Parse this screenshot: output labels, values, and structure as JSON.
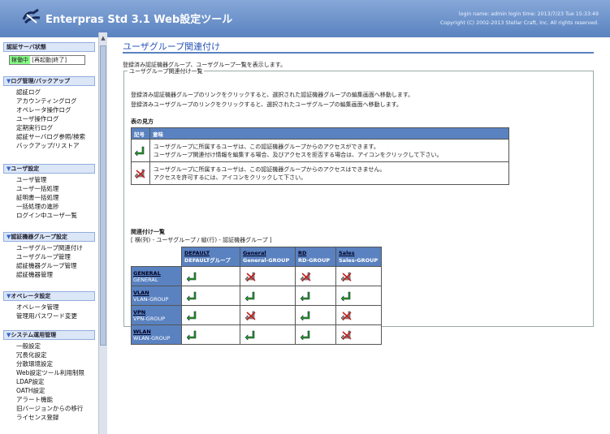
{
  "header": {
    "title": "Enterpras Std 3.1 Web設定ツール",
    "login_line": "login name: admin login time: 2013/7/23 Tue 15:33:49",
    "copyright_line": "Copyright (C) 2002-2013 Stellar Craft, Inc. All rights reserved."
  },
  "sidebar": {
    "server_status": {
      "title": "認証サーバ状態",
      "state": "稼働中",
      "restart": "再起動",
      "stop": "終了"
    },
    "sections": [
      {
        "title": "ログ管理/バックアップ",
        "items": [
          "認証ログ",
          "アカウンティングログ",
          "オペレータ操作ログ",
          "ユーザ操作ログ",
          "定期実行ログ",
          "認証サーバログ参照/検索",
          "バックアップ/リストア"
        ]
      },
      {
        "title": "ユーザ設定",
        "items": [
          "ユーザ管理",
          "ユーザ一括処理",
          "証明書一括処理",
          "一括処理の進捗",
          "ログイン中ユーザ一覧"
        ]
      },
      {
        "title": "認証機器グループ設定",
        "items": [
          "ユーザグループ関連付け",
          "ユーザグループ管理",
          "認証機器グループ管理",
          "認証機器管理"
        ]
      },
      {
        "title": "オペレータ設定",
        "items": [
          "オペレータ管理",
          "管理用パスワード変更"
        ]
      },
      {
        "title": "システム運用管理",
        "items": [
          "一般設定",
          "冗長化設定",
          "分散環境設定",
          "Web設定ツール利用制限",
          "LDAP設定",
          "OATH設定",
          "アラート機能",
          "旧バージョンからの移行",
          "ライセンス登録"
        ]
      }
    ]
  },
  "main": {
    "title": "ユーザグループ関連付け",
    "intro": "登録済み認証機器グループ、ユーザグループ一覧を表示します。",
    "fieldset_legend": "ユーザグループ関連付け一覧",
    "desc1": "登録済み認証機器グループのリンクをクリックすると、選択された認証機器グループの編集画面へ移動します。",
    "desc2": "登録済みユーザグループのリンクをクリックすると、選択されたユーザグループの編集画面へ移動します。",
    "legend_heading": "表の見方",
    "legend_cols": [
      "記号",
      "意味"
    ],
    "legend_rows": [
      {
        "line1": "ユーザグループに所属するユーザは、この認証機器グループからのアクセスができます。",
        "line2": "ユーザグループ関連付け情報を編集する場合、及びアクセスを拒否する場合は、アイコンをクリックして下さい。"
      },
      {
        "line1": "ユーザグループに所属するユーザは、この認証機器グループからのアクセスはできません。",
        "line2": "アクセスを許可するには、アイコンをクリックして下さい。"
      }
    ],
    "rel_heading": "関連付け一覧",
    "rel_note": "[ 横(列) - ユーザグループ / 縦(行) - 認証機器グループ ]",
    "columns": [
      {
        "name": "DEFAULT",
        "sub": "DEFAULTグループ"
      },
      {
        "name": "General",
        "sub": "General-GROUP"
      },
      {
        "name": "RD",
        "sub": "RD-GROUP"
      },
      {
        "name": "Sales",
        "sub": "Sales-GROUP"
      }
    ],
    "rows": [
      {
        "name": "GENERAL",
        "sub": "GENERAL",
        "cells": [
          "allow",
          "deny",
          "deny",
          "deny"
        ]
      },
      {
        "name": "VLAN",
        "sub": "VLAN-GROUP",
        "cells": [
          "allow",
          "allow",
          "allow",
          "allow"
        ]
      },
      {
        "name": "VPN",
        "sub": "VPN-GROUP",
        "cells": [
          "allow",
          "deny",
          "allow",
          "deny"
        ]
      },
      {
        "name": "WLAN",
        "sub": "WLAN-GROUP",
        "cells": [
          "allow",
          "allow",
          "allow",
          "deny"
        ]
      }
    ]
  },
  "colors": {
    "header": "#5a82c0",
    "allow": "#2a9a1a",
    "deny": "#c02020"
  }
}
